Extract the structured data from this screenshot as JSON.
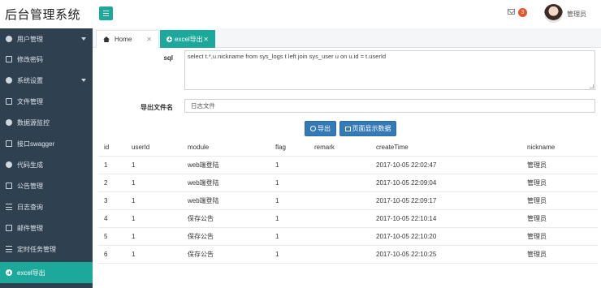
{
  "app": {
    "title": "后台管理系统"
  },
  "header": {
    "mail_count": "3",
    "username": "管理员",
    "icons": [
      "menu-icon",
      "envelope-icon",
      "user-avatar"
    ]
  },
  "sidebar": {
    "items": [
      {
        "label": "用户管理",
        "icon": "users-icon",
        "has_submenu": true
      },
      {
        "label": "修改密码",
        "icon": "edit-icon"
      },
      {
        "label": "系统设置",
        "icon": "gears-icon",
        "has_submenu": true
      },
      {
        "label": "文件管理",
        "icon": "folder-icon"
      },
      {
        "label": "数据源监控",
        "icon": "eye-icon"
      },
      {
        "label": "接口swagger",
        "icon": "file-icon"
      },
      {
        "label": "代码生成",
        "icon": "wrench-icon"
      },
      {
        "label": "公告管理",
        "icon": "bullhorn-icon"
      },
      {
        "label": "日志查询",
        "icon": "list-icon"
      },
      {
        "label": "邮件管理",
        "icon": "envelope-icon"
      },
      {
        "label": "定时任务管理",
        "icon": "tasks-icon"
      },
      {
        "label": "excel导出",
        "icon": "plus-circle-icon",
        "active": true
      }
    ]
  },
  "tabs": [
    {
      "label": "Home",
      "icon": "home-icon"
    },
    {
      "label": "excel导出",
      "icon": "plus-circle-icon",
      "active": true
    }
  ],
  "form": {
    "sql_label": "sql",
    "sql_value": "select t.*,u.nickname from sys_logs t left join sys_user u on u.id = t.userId",
    "filename_label": "导出文件名",
    "filename_value": "日志文件",
    "export_button": "导出",
    "show_button": "页面显示数据"
  },
  "table": {
    "headers": [
      "id",
      "userId",
      "module",
      "flag",
      "remark",
      "createTime",
      "nickname"
    ],
    "rows": [
      [
        "1",
        "1",
        "web端登陆",
        "1",
        "",
        "2017-10-05 22:02:47",
        "管理员"
      ],
      [
        "2",
        "1",
        "web端登陆",
        "1",
        "",
        "2017-10-05 22:09:04",
        "管理员"
      ],
      [
        "3",
        "1",
        "web端登陆",
        "1",
        "",
        "2017-10-05 22:09:17",
        "管理员"
      ],
      [
        "4",
        "1",
        "保存公告",
        "1",
        "",
        "2017-10-05 22:10:14",
        "管理员"
      ],
      [
        "5",
        "1",
        "保存公告",
        "1",
        "",
        "2017-10-05 22:10:20",
        "管理员"
      ],
      [
        "6",
        "1",
        "保存公告",
        "1",
        "",
        "2017-10-05 22:10:25",
        "管理员"
      ]
    ]
  },
  "colors": {
    "accent": "#1ca89a",
    "sidebar": "#2f4050",
    "primary_button": "#337ab7",
    "badge": "#e8542e"
  }
}
